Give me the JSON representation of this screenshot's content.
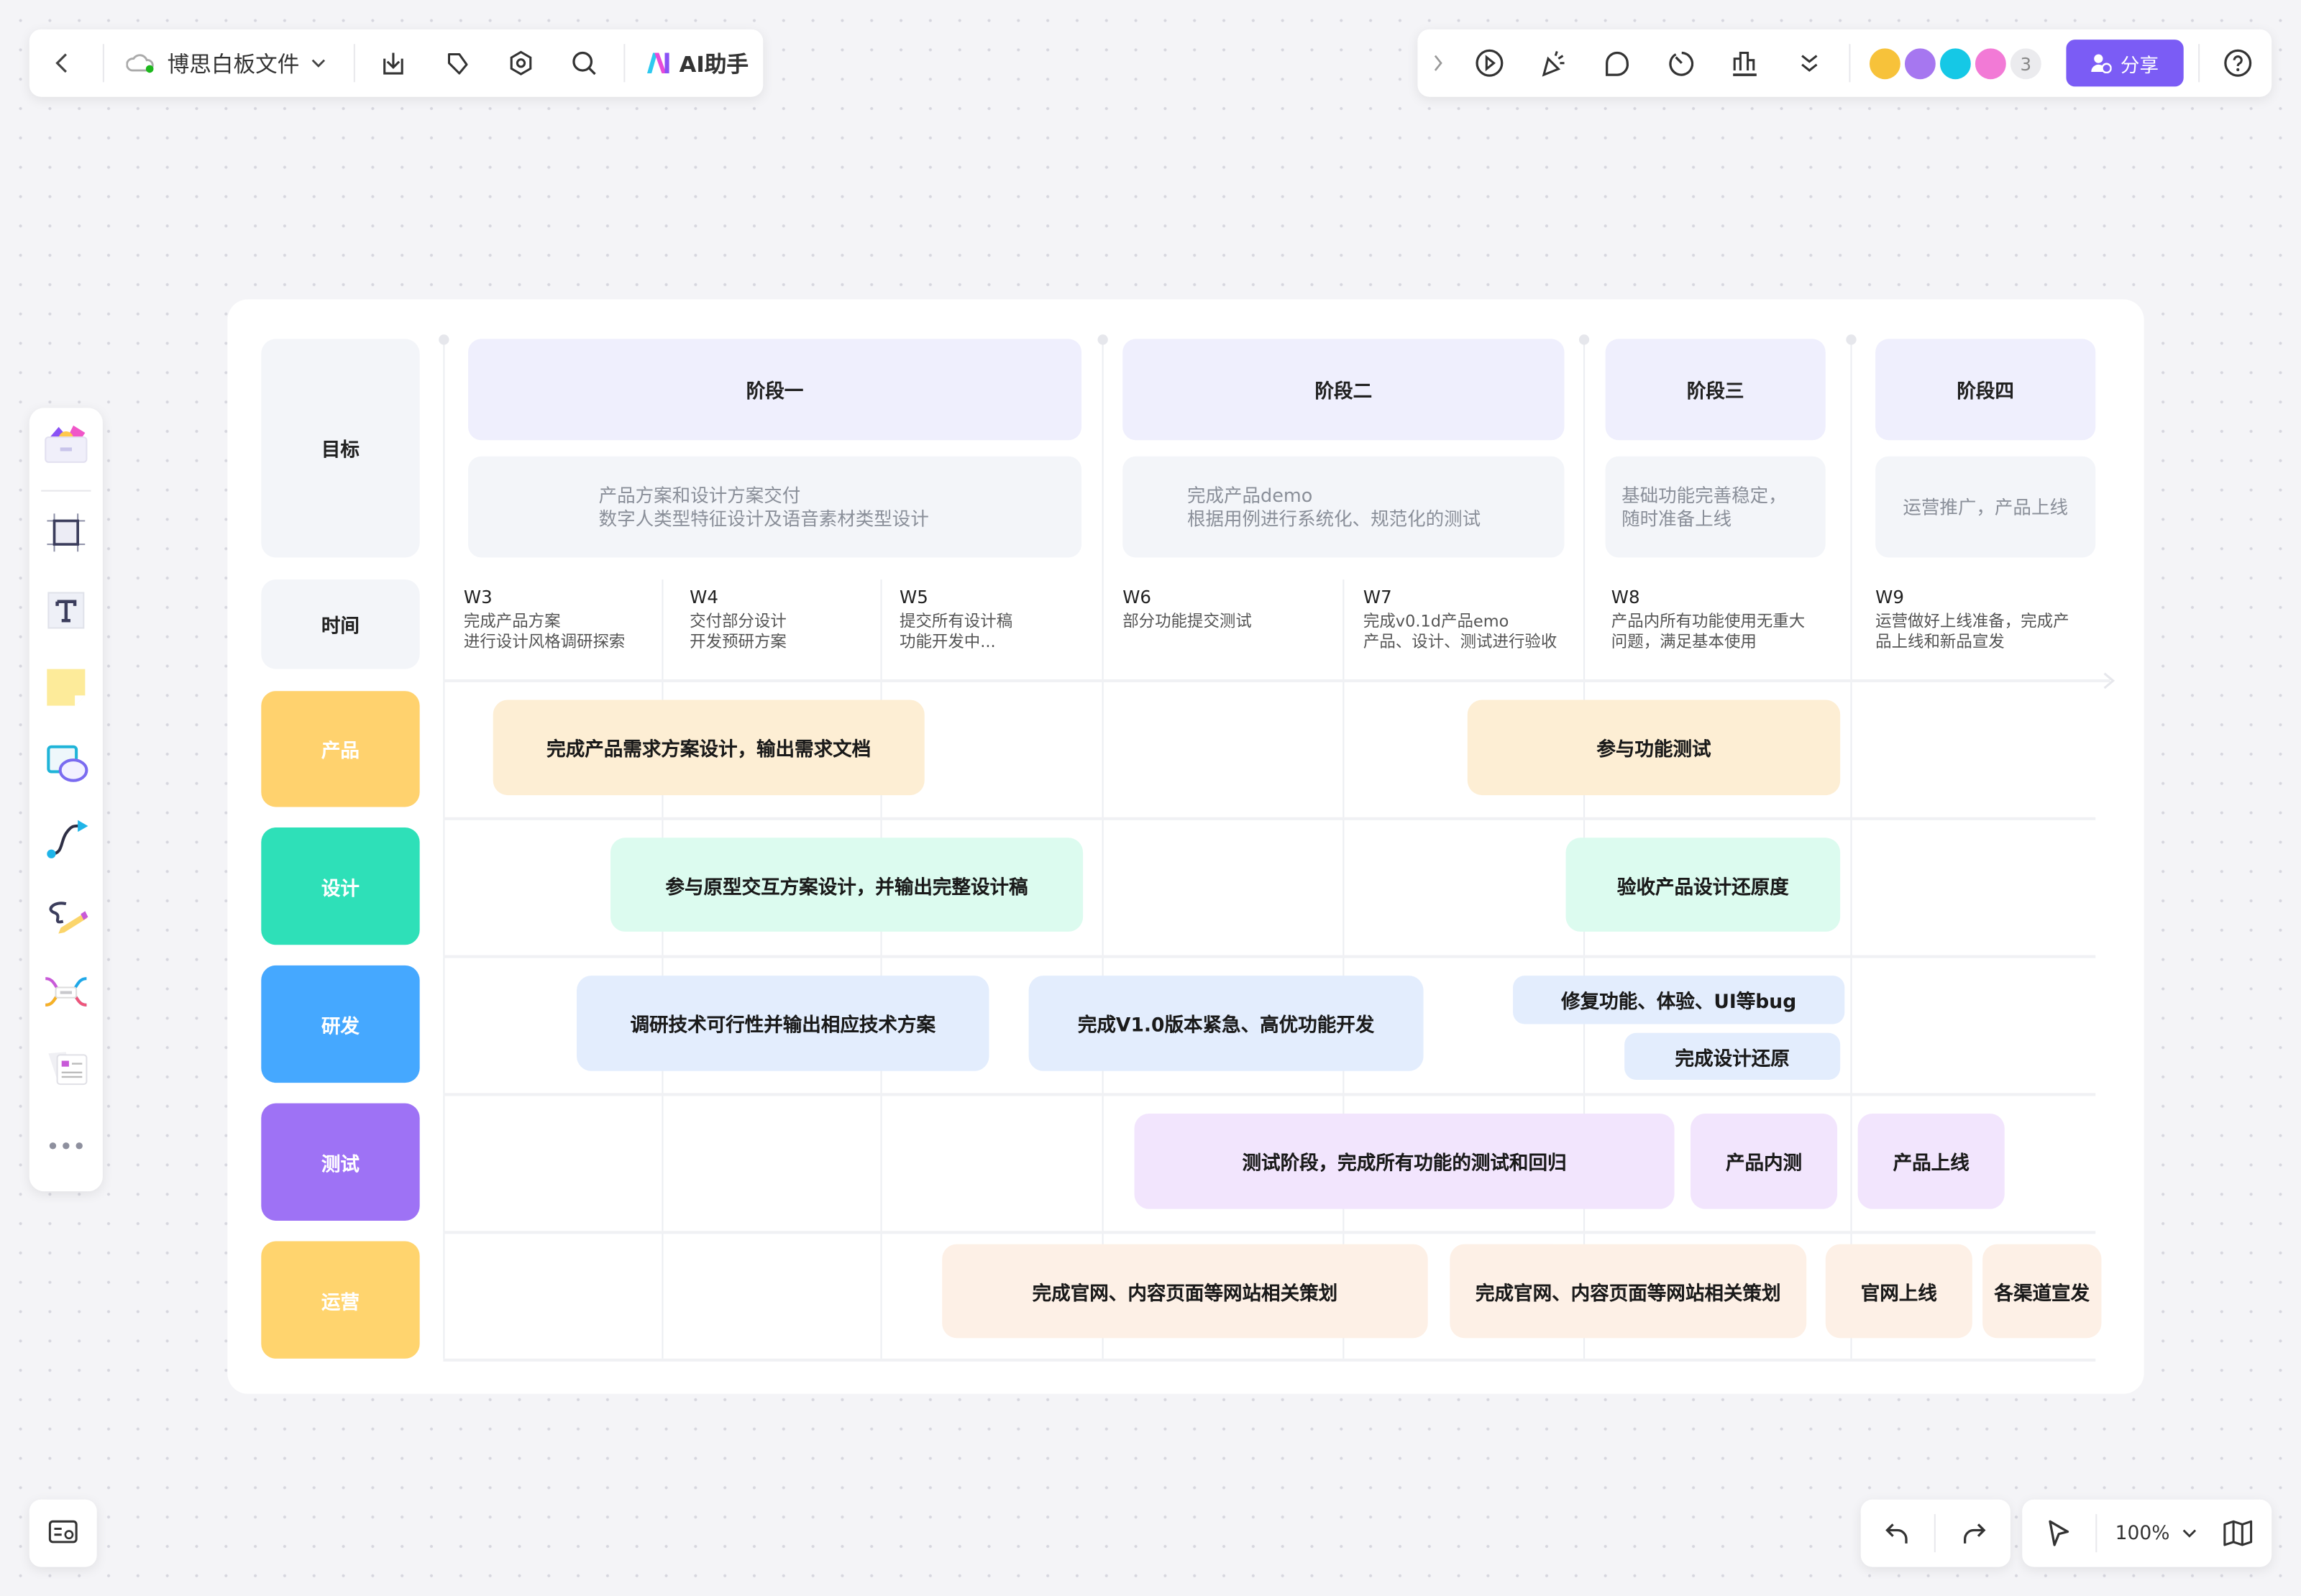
{
  "topbar": {
    "file_name": "博思白板文件",
    "ai_label": "AI助手",
    "share_label": "分享",
    "member_count": "3",
    "icons": [
      "back-icon",
      "cloud-sync-icon",
      "download-icon",
      "tag-icon",
      "settings-icon",
      "search-icon",
      "ai-logo-icon"
    ],
    "right_icons": [
      "expand-icon",
      "play-icon",
      "celebrate-icon",
      "comment-icon",
      "timer-icon",
      "vote-icon",
      "more-icon",
      "help-icon"
    ]
  },
  "colors": {
    "accent": "#7b5cf5",
    "product": "#ffd26e",
    "design": "#2ee0b8",
    "dev": "#45a8ff",
    "test": "#9e72f5",
    "ops": "#ffd46e"
  },
  "left_toolbar": [
    "template-icon",
    "frame-icon",
    "text-icon",
    "sticky-note-icon",
    "shape-icon",
    "connector-icon",
    "pen-icon",
    "mindmap-icon",
    "card-icon",
    "more-icon"
  ],
  "bottom": {
    "zoom": "100%"
  },
  "board": {
    "row_headers": {
      "goal": "目标",
      "time": "时间",
      "product": "产品",
      "design": "设计",
      "dev": "研发",
      "test": "测试",
      "ops": "运营"
    },
    "phases": [
      {
        "title": "阶段一",
        "desc": "产品方案和设计方案交付\n数字人类型特征设计及语音素材类型设计"
      },
      {
        "title": "阶段二",
        "desc": "完成产品demo\n根据用例进行系统化、规范化的测试"
      },
      {
        "title": "阶段三",
        "desc": "基础功能完善稳定，\n随时准备上线"
      },
      {
        "title": "阶段四",
        "desc": "运营推广，产品上线"
      }
    ],
    "weeks": [
      {
        "label": "W3",
        "desc": "完成产品方案\n进行设计风格调研探索"
      },
      {
        "label": "W4",
        "desc": "交付部分设计\n开发预研方案"
      },
      {
        "label": "W5",
        "desc": "提交所有设计稿\n功能开发中..."
      },
      {
        "label": "W6",
        "desc": "部分功能提交测试"
      },
      {
        "label": "W7",
        "desc": "完成v0.1d产品emo\n产品、设计、测试进行验收"
      },
      {
        "label": "W8",
        "desc": "产品内所有功能使用无重大\n问题，满足基本使用"
      },
      {
        "label": "W9",
        "desc": "运营做好上线准备，完成产\n品上线和新品宣发"
      }
    ],
    "tasks": {
      "product": [
        "完成产品需求方案设计，输出需求文档",
        "参与功能测试"
      ],
      "design": [
        "参与原型交互方案设计，并输出完整设计稿",
        "验收产品设计还原度"
      ],
      "dev": [
        "调研技术可行性并输出相应技术方案",
        "完成V1.0版本紧急、高优功能开发",
        "修复功能、体验、UI等bug",
        "完成设计还原"
      ],
      "test": [
        "测试阶段，完成所有功能的测试和回归",
        "产品内测",
        "产品上线"
      ],
      "ops": [
        "完成官网、内容页面等网站相关策划",
        "完成官网、内容页面等网站相关策划",
        "官网上线",
        "各渠道宣发"
      ]
    }
  }
}
